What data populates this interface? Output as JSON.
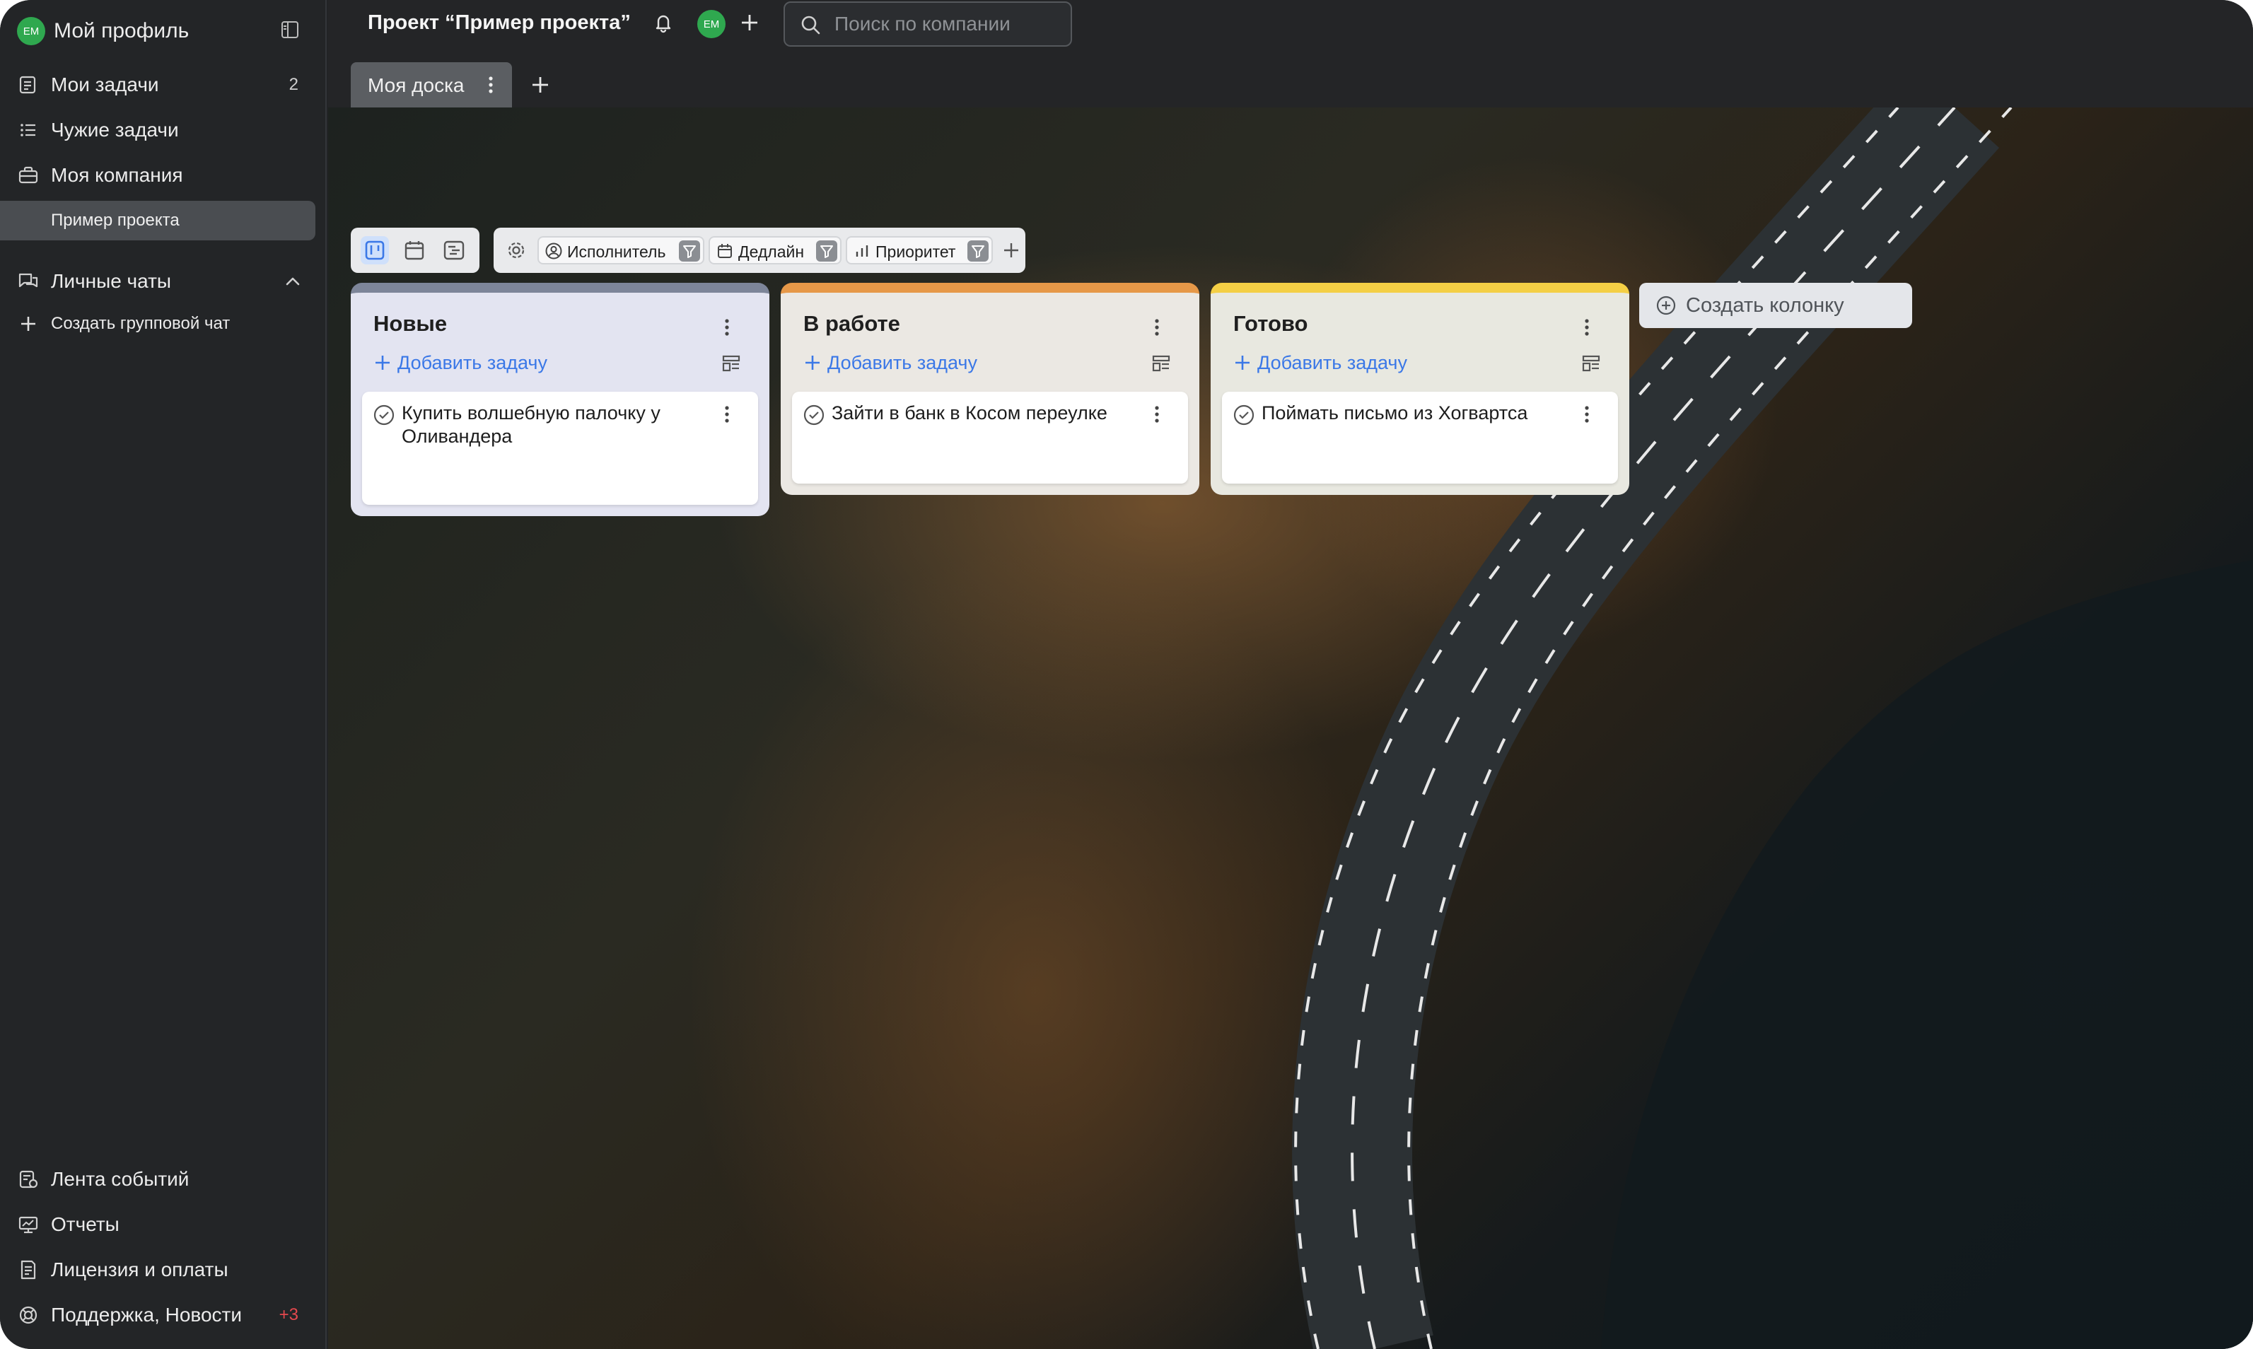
{
  "colors": {
    "sidebar_bg": "#232527",
    "accent_blue": "#3b78e7",
    "avatar_green": "#2fa84f",
    "col_new": "#7d8599",
    "col_in_progress": "#e69848",
    "col_done": "#f4cf45"
  },
  "sidebar": {
    "profile": {
      "avatar": "EM",
      "label": "Мой профиль"
    },
    "items": [
      {
        "icon": "tasks-icon",
        "label": "Мои задачи",
        "count": "2"
      },
      {
        "icon": "list-icon",
        "label": "Чужие задачи"
      },
      {
        "icon": "briefcase-icon",
        "label": "Моя компания"
      }
    ],
    "project": "Пример проекта",
    "chats": {
      "label": "Личные чаты",
      "create": "Создать групповой чат"
    },
    "bottom": [
      {
        "icon": "feed-icon",
        "label": "Лента событий"
      },
      {
        "icon": "reports-icon",
        "label": "Отчеты"
      },
      {
        "icon": "license-icon",
        "label": "Лицензия и оплаты"
      },
      {
        "icon": "support-icon",
        "label": "Поддержка, Новости",
        "count": "+3"
      }
    ]
  },
  "header": {
    "title": "Проект “Пример проекта”",
    "avatar": "EM",
    "search_placeholder": "Поиск по компании"
  },
  "tabs": [
    {
      "label": "Моя доска",
      "active": true
    }
  ],
  "filters": [
    {
      "icon": "user-icon",
      "label": "Исполнитель"
    },
    {
      "icon": "calendar-icon",
      "label": "Дедлайн"
    },
    {
      "icon": "bars-icon",
      "label": "Приоритет"
    }
  ],
  "columns": [
    {
      "title": "Новые",
      "color": "#7d8599",
      "add_label": "Добавить задачу",
      "cards": [
        "Купить волшебную палочку у Оливандера"
      ]
    },
    {
      "title": "В работе",
      "color": "#e69848",
      "add_label": "Добавить задачу",
      "cards": [
        "Зайти в банк в Косом переулке"
      ]
    },
    {
      "title": "Готово",
      "color": "#f4cf45",
      "add_label": "Добавить задачу",
      "cards": [
        "Поймать письмо из Хогвартса"
      ]
    }
  ],
  "add_column_label": "Создать колонку"
}
